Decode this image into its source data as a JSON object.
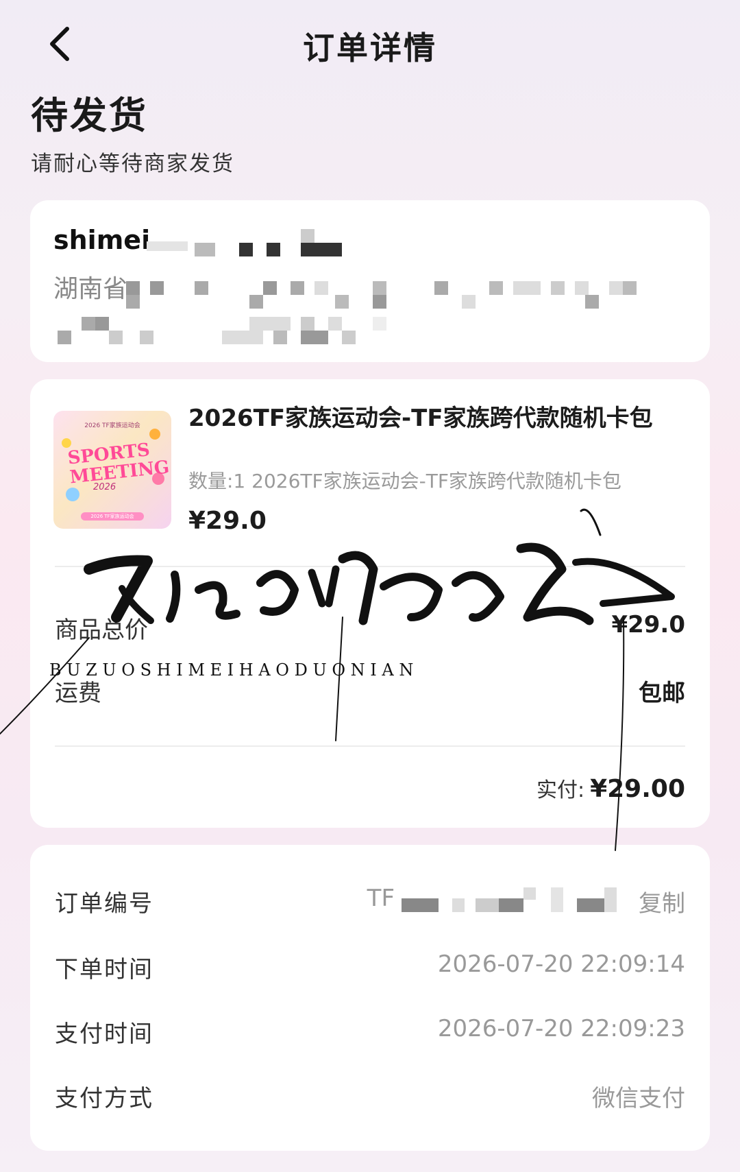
{
  "header": {
    "title": "订单详情",
    "back_icon": "chevron-left-icon"
  },
  "status": {
    "title": "待发货",
    "subtitle": "请耐心等待商家发货"
  },
  "address": {
    "name": "shimei",
    "line1": "湖南省"
  },
  "product": {
    "image_texts": {
      "top": "2026 TF家族运动会",
      "main_line1": "SPORTS",
      "main_line2": "MEETING",
      "year": "2026",
      "foot": "2026 TF家族运动会"
    },
    "title": "2026TF家族运动会-TF家族跨代款随机卡包",
    "desc": "数量:1 2026TF家族运动会-TF家族跨代款随机卡包",
    "price": "¥29.0"
  },
  "summary": {
    "subtotal_label": "商品总价",
    "subtotal_value": "¥29.0",
    "shipping_label": "运费",
    "shipping_value": "包邮",
    "paid_label": "实付:",
    "paid_value": "¥29.00"
  },
  "order_info": {
    "order_no_label": "订单编号",
    "order_no_value": "TF",
    "copy_label": "复制",
    "order_time_label": "下单时间",
    "order_time_value": "2026-07-20 22:09:14",
    "pay_time_label": "支付时间",
    "pay_time_value": "2026-07-20 22:09:23",
    "pay_method_label": "支付方式",
    "pay_method_value": "微信支付"
  },
  "watermark": {
    "pinyin": "B U Z U O S H I M E I H A O D U O N I A N"
  }
}
